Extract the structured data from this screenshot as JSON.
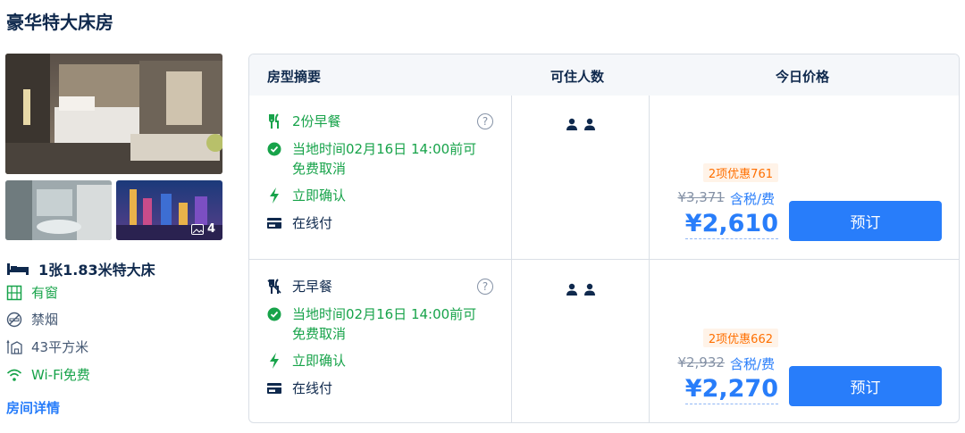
{
  "room": {
    "title": "豪华特大床房",
    "photo_count": "4",
    "bed": "1张1.83米特大床",
    "features": [
      {
        "label": "有窗",
        "icon": "window-icon"
      },
      {
        "label": "禁烟",
        "icon": "no-smoking-icon"
      },
      {
        "label": "43平方米",
        "icon": "area-icon"
      },
      {
        "label": "Wi-Fi免费",
        "icon": "wifi-icon"
      }
    ],
    "detail_link": "房间详情"
  },
  "table": {
    "headers": [
      "房型摘要",
      "可住人数",
      "今日价格"
    ],
    "rows": [
      {
        "meal": "2份早餐",
        "cancel": "当地时间02月16日 14:00前可免费取消",
        "confirm": "立即确认",
        "payment": "在线付",
        "help": "?",
        "promo": "2项优惠761",
        "original_price": "¥3,371",
        "tax_label": "含税/费",
        "price": "¥2,610",
        "book_label": "预订",
        "guests": 2
      },
      {
        "meal": "无早餐",
        "cancel": "当地时间02月16日 14:00前可免费取消",
        "confirm": "立即确认",
        "payment": "在线付",
        "help": "?",
        "promo": "2项优惠662",
        "original_price": "¥2,932",
        "tax_label": "含税/费",
        "price": "¥2,270",
        "book_label": "预订",
        "guests": 2
      }
    ]
  },
  "colors": {
    "brand_blue": "#287dfa",
    "green": "#17a34a",
    "promo_orange": "#ff6f00",
    "text": "#0f294d"
  }
}
